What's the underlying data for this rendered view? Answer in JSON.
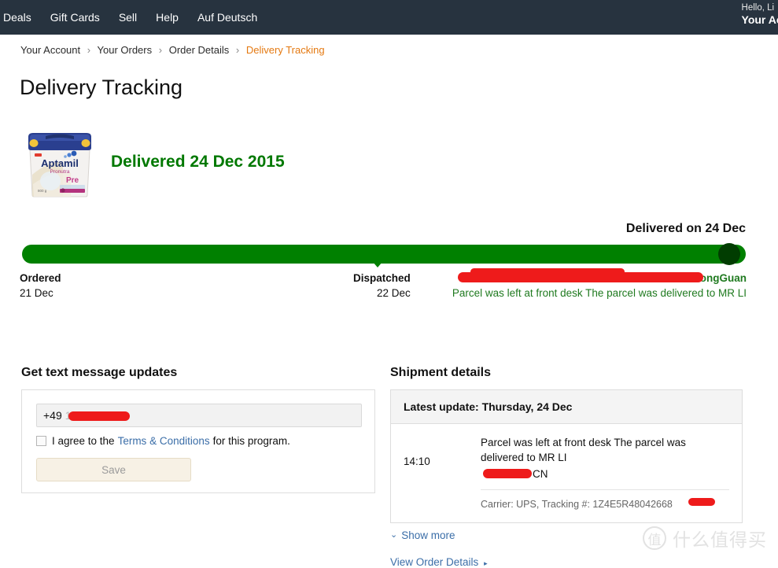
{
  "nav": {
    "links": [
      "Deals",
      "Gift Cards",
      "Sell",
      "Help",
      "Auf Deutsch"
    ],
    "greeting": "Hello, Li",
    "account_label": "Your Acco"
  },
  "breadcrumb": {
    "items": [
      "Your Account",
      "Your Orders",
      "Order Details",
      "Delivery Tracking"
    ],
    "separator": "›"
  },
  "page": {
    "title": "Delivery Tracking"
  },
  "product": {
    "brand": "Aptamil",
    "subbrand": "Pronutra",
    "variant": "Pre",
    "weight": "800 g"
  },
  "status": {
    "headline": "Delivered 24 Dec 2015",
    "color": "#007800"
  },
  "tracker": {
    "delivered_label": "Delivered on 24 Dec",
    "bar_color": "#008000",
    "dot_color": "#013d01",
    "progress_percent": 100,
    "steps": [
      {
        "name": "Ordered",
        "date": "21 Dec"
      },
      {
        "name": "Dispatched",
        "date": "22 Dec"
      }
    ],
    "delivery_address": "DongGuan",
    "delivery_message": "Parcel was left at front desk The parcel was delivered to MR LI"
  },
  "sms": {
    "title": "Get text message updates",
    "country_code": "+49",
    "phone_masked": "1",
    "agree_prefix": "I agree to the",
    "agree_link": "Terms & Conditions",
    "agree_suffix": "for this program.",
    "save_label": "Save",
    "checkbox_checked": false
  },
  "shipment": {
    "title": "Shipment details",
    "latest_update": "Latest update: Thursday, 24 Dec",
    "event": {
      "time": "14:10",
      "description": "Parcel was left at front desk The parcel was delivered to MR LI",
      "location_country": "CN",
      "carrier_text": "Carrier: UPS, Tracking #: 1Z4E5R48042668"
    },
    "show_more_label": "Show more",
    "show_more_icon": "chevron-double-down",
    "view_order_label": "View Order Details",
    "view_order_icon": "arrow-right"
  },
  "watermark": {
    "logo_char": "值",
    "text": "什么值得买"
  }
}
